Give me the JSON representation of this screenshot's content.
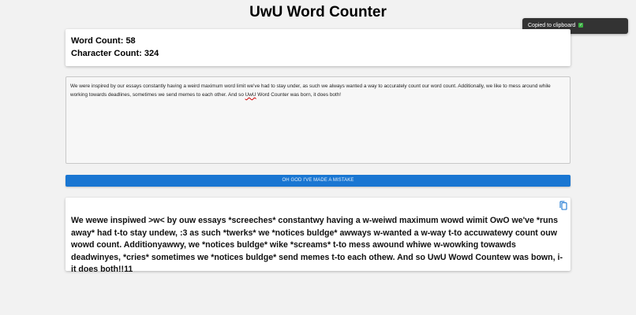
{
  "header": {
    "title": "UwU Word Counter"
  },
  "toast": {
    "message": "Copied to clipboard",
    "icon": "check-icon",
    "icon_glyph": "✓"
  },
  "stats": {
    "word_count": "Word Count: 58",
    "character_count": "Character Count: 324"
  },
  "editor": {
    "text_before": "We were inspired by our essays constantly having a weird maximum word limit we've had to stay under, as such we always wanted a way to accurately count our word count. Additionally, we like to mess around while working towards deadlines, sometimes we send memes to each other. And so ",
    "misspelled_word": "UwU",
    "text_after": " Word Counter was born, it does both!"
  },
  "mistake_button": {
    "label": "OH GOD I'VE MADE A MISTAKE"
  },
  "output": {
    "copy_icon": "copy-icon",
    "text": "We wewe inspiwed >w< by ouw essays *screeches* constantwy having a w-weiwd maximum wowd wimit OwO we've *runs away* had t-to stay undew, :3 as such *twerks* we *notices buldge* awways w-wanted a w-way t-to accuwatewy count ouw wowd count. Additionyawwy, we *notices buldge* wike *screams* t-to mess awound whiwe w-wowking towawds deadwinyes, *cries* sometimes we *notices buldge* send memes t-to each othew. And so UwU Wowd Countew was bown, i-it does both!!11"
  },
  "colors": {
    "background": "#f2f2f2",
    "accent_button": "#1976d2",
    "toast_background": "#333333",
    "toast_check": "#3cb043"
  }
}
